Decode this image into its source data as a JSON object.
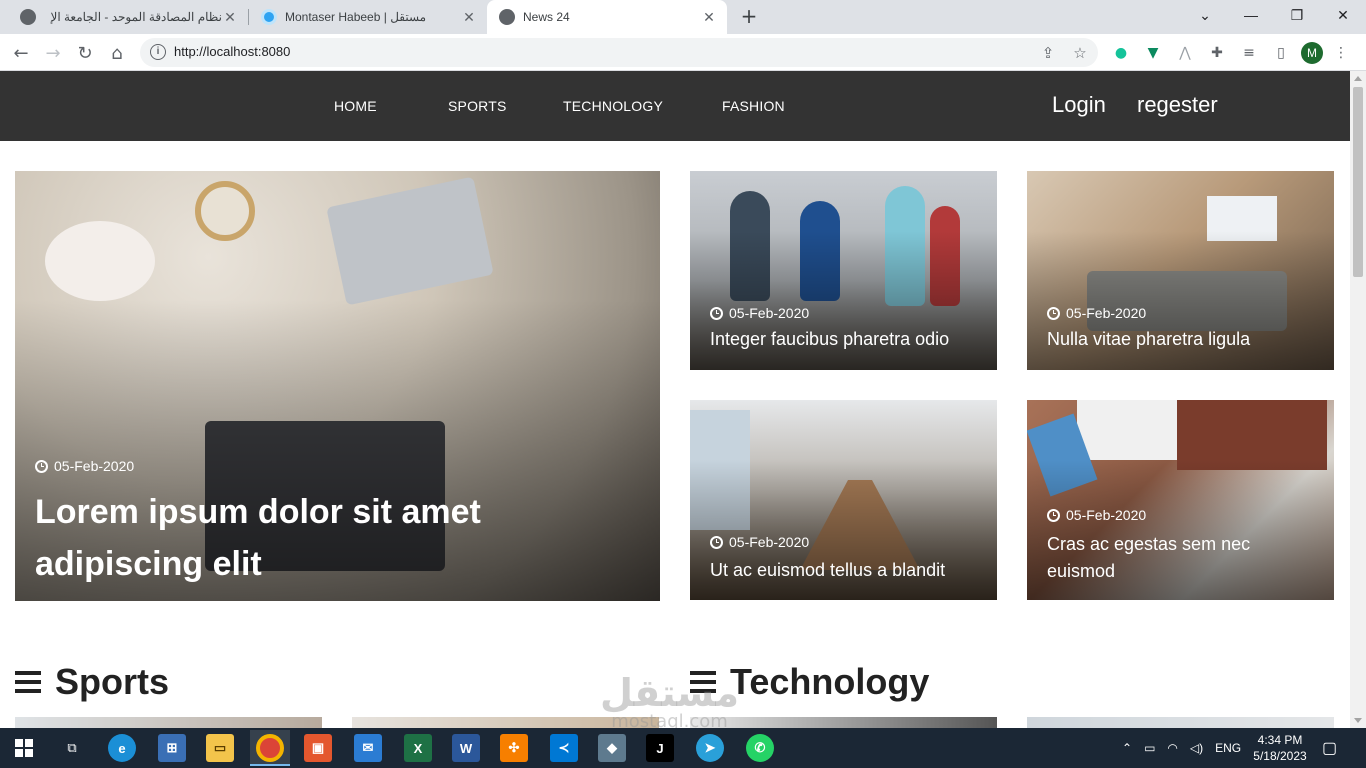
{
  "browser": {
    "tabs": [
      {
        "title": "نظام المصادقة الموحد - الجامعة الإ",
        "icon": "globe-icon"
      },
      {
        "title": "Montaser Habeeb | مستقل",
        "icon": "mostaql-icon"
      },
      {
        "title": "News 24",
        "icon": "globe-icon"
      }
    ],
    "url": "http://localhost:8080",
    "profile_initial": "M"
  },
  "site": {
    "menu": [
      "HOME",
      "SPORTS",
      "TECHNOLOGY",
      "FASHION"
    ],
    "login": "Login",
    "register": "regester"
  },
  "featured": {
    "main": {
      "date": "05-Feb-2020",
      "title_line1": "Lorem ipsum dolor sit amet",
      "title_line2": "adipiscing elit"
    },
    "cards": [
      {
        "date": "05-Feb-2020",
        "title": "Integer faucibus pharetra odio"
      },
      {
        "date": "05-Feb-2020",
        "title": "Nulla vitae pharetra ligula"
      },
      {
        "date": "05-Feb-2020",
        "title": "Ut ac euismod tellus a blandit"
      },
      {
        "date": "05-Feb-2020",
        "title_line1": "Cras ac egestas sem nec",
        "title_line2": "euismod"
      }
    ]
  },
  "sections": {
    "sports": "Sports",
    "technology": "Technology"
  },
  "watermark": {
    "arabic": "مستقل",
    "latin": "mostaql.com"
  },
  "taskbar": {
    "language": "ENG",
    "time": "4:34 PM",
    "date": "5/18/2023"
  }
}
